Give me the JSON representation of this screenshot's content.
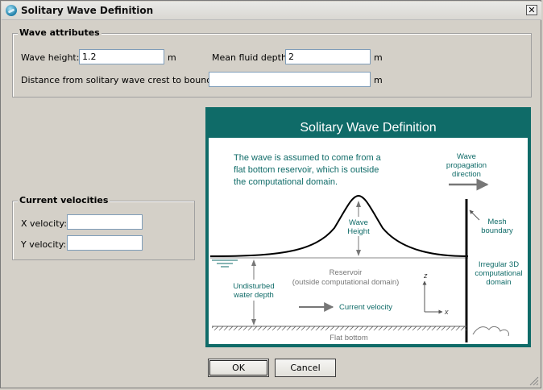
{
  "window": {
    "title": "Solitary Wave Definition",
    "close_glyph": "✕"
  },
  "wave_attributes": {
    "legend": "Wave attributes",
    "wave_height_label": "Wave height:",
    "wave_height_value": "1.2",
    "wave_height_unit": "m",
    "depth_label": "Mean fluid depth:",
    "depth_value": "2",
    "depth_unit": "m",
    "distance_label": "Distance from solitary wave crest to boundary:",
    "distance_value": "",
    "distance_unit": "m"
  },
  "current_velocities": {
    "legend": "Current velocities",
    "x_label": "X velocity:",
    "x_value": "",
    "y_label": "Y velocity:",
    "y_value": ""
  },
  "diagram": {
    "title": "Solitary Wave Definition",
    "intro_1": "The wave is assumed to come from a",
    "intro_2": "flat bottom reservoir, which is outside",
    "intro_3": "the computational domain.",
    "propagation_1": "Wave",
    "propagation_2": "propagation",
    "propagation_3": "direction",
    "wave_height_1": "Wave",
    "wave_height_2": "Height",
    "mesh_1": "Mesh",
    "mesh_2": "boundary",
    "reservoir_1": "Reservoir",
    "reservoir_2": "(outside computational domain)",
    "irregular_1": "Irregular 3D",
    "irregular_2": "computational",
    "irregular_3": "domain",
    "undisturbed_1": "Undisturbed",
    "undisturbed_2": "water depth",
    "current_velocity": "Current velocity",
    "axis_z": "z",
    "axis_x": "x",
    "flat_bottom": "Flat bottom",
    "colors": {
      "frame": "#0f6b68",
      "text": "#0f6b68",
      "gray": "#777777"
    }
  },
  "buttons": {
    "ok": "OK",
    "cancel": "Cancel"
  }
}
